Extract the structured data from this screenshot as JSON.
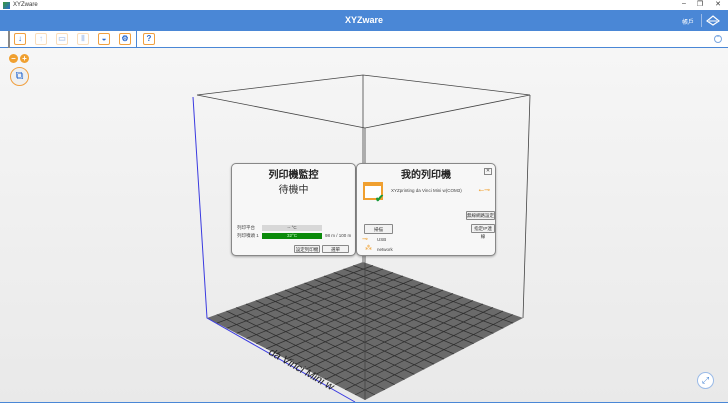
{
  "window": {
    "title": "XYZware",
    "minimize": "–",
    "maximize": "❐",
    "close": "✕"
  },
  "header": {
    "title": "XYZware",
    "account": "帳戶"
  },
  "toolbar": {
    "help": "?"
  },
  "zoom": {
    "out": "–",
    "in": "+"
  },
  "monitor": {
    "title": "列印機監控",
    "status": "待機中",
    "bed_label": "列印平台",
    "bed_temp": "-- °C",
    "nozzle_label": "列印噴頭 1",
    "nozzle_temp": "32°C",
    "nozzle_progress": 1.0,
    "filament": "98 m / 100 m",
    "btn_left": "設定列印機",
    "btn_right": "選單"
  },
  "myprinter": {
    "title": "我的列印機",
    "close": "✕",
    "printer_name": "XYZprinting da Vinci Mini w(COM3)",
    "wifi_btn": "無線網路設定",
    "ip_btn": "指定IP連線",
    "scan_btn": "掃描",
    "usb_label": "USB",
    "network_label": "network"
  },
  "scene": {
    "model_label": "da Vinci Mini w"
  },
  "colors": {
    "accent": "#4a87d6",
    "orange": "#f0a030",
    "progress": "#0a8a0a"
  }
}
